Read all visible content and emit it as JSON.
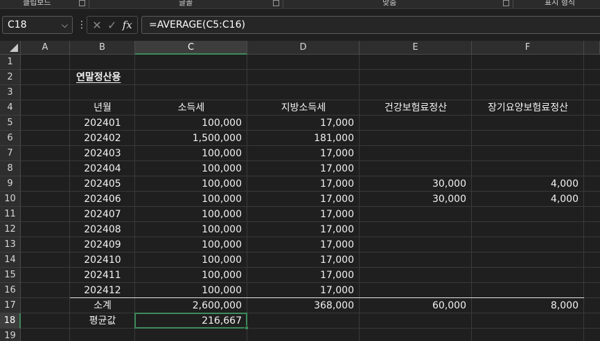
{
  "ribbon": {
    "groups": [
      {
        "label": "클립보드",
        "launcher": true
      },
      {
        "label": "글꼴",
        "launcher": true
      },
      {
        "label": "맞춤",
        "launcher": true
      },
      {
        "label": "표시 형식",
        "launcher": false
      }
    ]
  },
  "formula_bar": {
    "name_box": "C18",
    "formula": "=AVERAGE(C5:C16)",
    "cancel_icon": "✕",
    "enter_icon": "✓",
    "fx_label": "fx"
  },
  "columns": [
    "A",
    "B",
    "C",
    "D",
    "E",
    "F"
  ],
  "selected_column": "C",
  "rows": [
    "1",
    "2",
    "3",
    "4",
    "5",
    "6",
    "7",
    "8",
    "9",
    "10",
    "11",
    "12",
    "13",
    "14",
    "15",
    "16",
    "17",
    "18",
    "19"
  ],
  "selected_row": "18",
  "sheet": {
    "title": "연말정산용",
    "headers": [
      "년월",
      "소득세",
      "지방소득세",
      "건강보험료정산",
      "장기요양보험료정산"
    ],
    "data_rows": [
      [
        "202401",
        "100,000",
        "17,000",
        "",
        ""
      ],
      [
        "202402",
        "1,500,000",
        "181,000",
        "",
        ""
      ],
      [
        "202403",
        "100,000",
        "17,000",
        "",
        ""
      ],
      [
        "202404",
        "100,000",
        "17,000",
        "",
        ""
      ],
      [
        "202405",
        "100,000",
        "17,000",
        "30,000",
        "4,000"
      ],
      [
        "202406",
        "100,000",
        "17,000",
        "30,000",
        "4,000"
      ],
      [
        "202407",
        "100,000",
        "17,000",
        "",
        ""
      ],
      [
        "202408",
        "100,000",
        "17,000",
        "",
        ""
      ],
      [
        "202409",
        "100,000",
        "17,000",
        "",
        ""
      ],
      [
        "202410",
        "100,000",
        "17,000",
        "",
        ""
      ],
      [
        "202411",
        "100,000",
        "17,000",
        "",
        ""
      ],
      [
        "202412",
        "100,000",
        "17,000",
        "",
        ""
      ]
    ],
    "subtotal": [
      "소계",
      "2,600,000",
      "368,000",
      "60,000",
      "8,000"
    ],
    "average": [
      "평균값",
      "216,667"
    ]
  },
  "colors": {
    "selection": "#3f8b5d",
    "background": "#1f1f1f",
    "header_bg": "#2e2e2e"
  }
}
